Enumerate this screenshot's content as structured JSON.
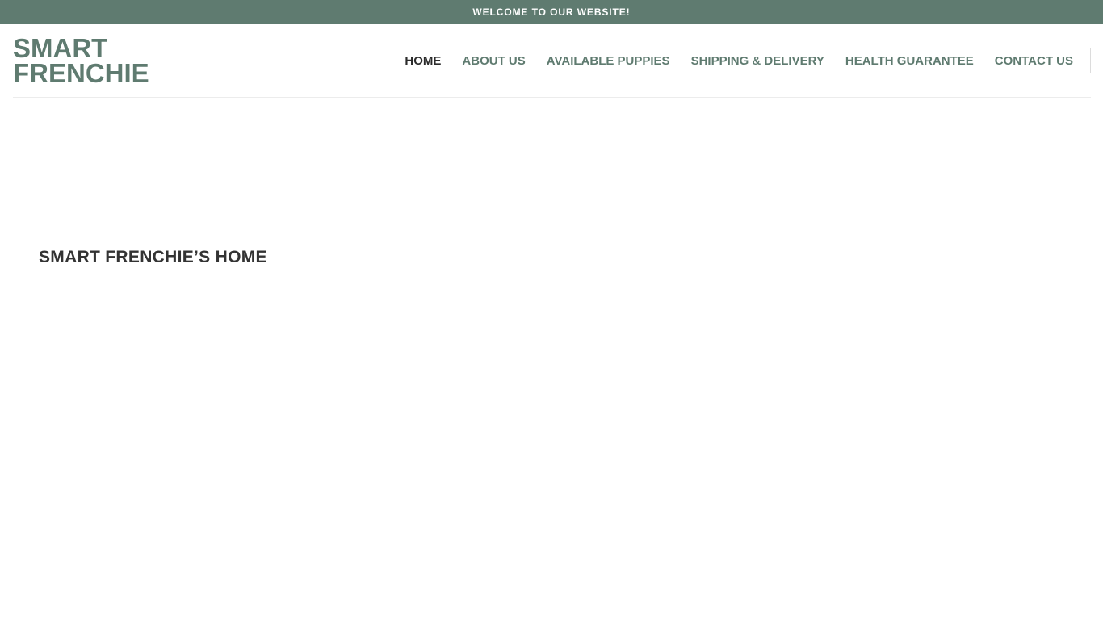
{
  "topbar": {
    "message": "WELCOME TO OUR WEBSITE!"
  },
  "brand": {
    "line1": "SMART",
    "line2": "FRENCHIE",
    "color": "#5f7b70"
  },
  "nav": {
    "items": [
      {
        "label": "HOME",
        "active": true
      },
      {
        "label": "ABOUT US",
        "active": false
      },
      {
        "label": "AVAILABLE PUPPIES",
        "active": false
      },
      {
        "label": "SHIPPING & DELIVERY",
        "active": false
      },
      {
        "label": "HEALTH GUARANTEE",
        "active": false
      },
      {
        "label": "CONTACT US",
        "active": false
      }
    ]
  },
  "main": {
    "heading": "SMART FRENCHIE’S HOME"
  },
  "colors": {
    "topbar_bg": "#5f7b70",
    "nav_text": "#5f7b70",
    "nav_active": "#2b2b2b",
    "heading_text": "#333333"
  }
}
